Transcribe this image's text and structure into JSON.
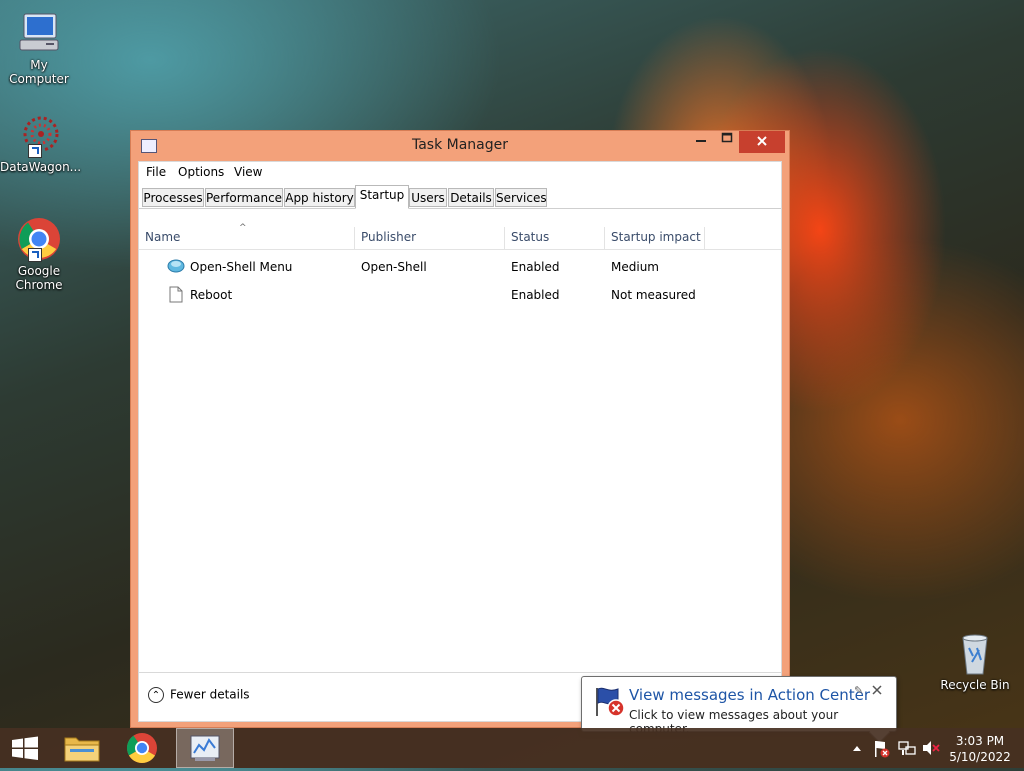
{
  "desktop": {
    "icons": [
      {
        "label": "My Computer"
      },
      {
        "label": "DataWagon..."
      },
      {
        "label": "Google Chrome"
      },
      {
        "label": "Recycle Bin"
      }
    ]
  },
  "window": {
    "title": "Task Manager",
    "menu": [
      "File",
      "Options",
      "View"
    ],
    "tabs": [
      "Processes",
      "Performance",
      "App history",
      "Startup",
      "Users",
      "Details",
      "Services"
    ],
    "active_tab": "Startup",
    "columns": [
      "Name",
      "Publisher",
      "Status",
      "Startup impact"
    ],
    "rows": [
      {
        "name": "Open-Shell Menu",
        "publisher": "Open-Shell",
        "status": "Enabled",
        "impact": "Medium"
      },
      {
        "name": "Reboot",
        "publisher": "",
        "status": "Enabled",
        "impact": "Not measured"
      }
    ],
    "footer": {
      "fewer_details": "Fewer details"
    }
  },
  "notification": {
    "title": "View messages in Action Center",
    "body": "Click to view messages about your computer."
  },
  "taskbar": {
    "time": "3:03 PM",
    "date": "5/10/2022"
  }
}
